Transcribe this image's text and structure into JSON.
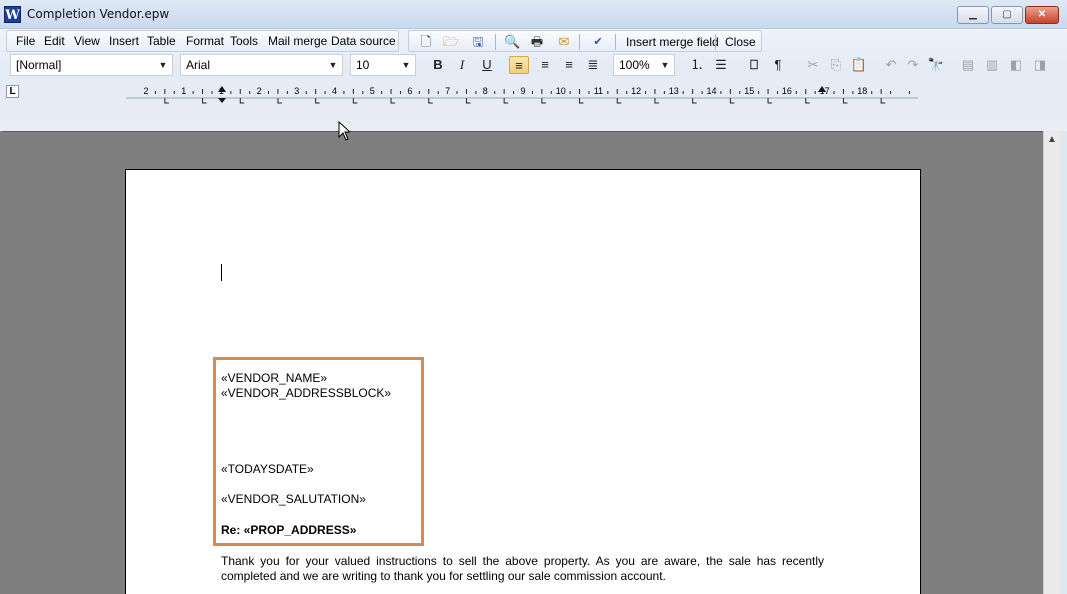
{
  "window": {
    "title": "Completion Vendor.epw",
    "app_icon": "W",
    "buttons": {
      "minimize": "▁",
      "maximize": "▢",
      "close": "✕"
    }
  },
  "menu": [
    "File",
    "Edit",
    "View",
    "Insert",
    "Table",
    "Format",
    "Tools",
    "Mail merge",
    "Data source"
  ],
  "toolbar": {
    "insert_merge_field": "Insert merge field",
    "close": "Close",
    "icons": [
      "new-document-icon",
      "open-folder-icon",
      "save-icon",
      "print-preview-icon",
      "print-icon",
      "email-icon",
      "spellcheck-icon"
    ]
  },
  "format": {
    "style": "[Normal]",
    "font": "Arial",
    "size": "10",
    "zoom": "100%",
    "active_alignment": "align-left"
  },
  "ruler": {
    "labels": [
      "2",
      "1",
      "1",
      "2",
      "3",
      "4",
      "5",
      "6",
      "7",
      "8",
      "9",
      "10",
      "11",
      "12",
      "13",
      "14",
      "15",
      "16",
      "17",
      "18"
    ],
    "corner": "L"
  },
  "document": {
    "merge_fields": {
      "vendor_name": "«VENDOR_NAME»",
      "vendor_address": "«VENDOR_ADDRESSBLOCK»",
      "todays_date": "«TODAYSDATE»",
      "vendor_salutation": "«VENDOR_SALUTATION»",
      "re_line": "Re: «PROP_ADDRESS»"
    },
    "body_paragraph": "Thank you for your valued instructions to sell the above property. As you are aware, the sale has recently completed and we are writing to thank you for settling our sale commission account."
  },
  "colors": {
    "highlight_border": "#e0874f",
    "workspace": "#7f7f7f"
  }
}
